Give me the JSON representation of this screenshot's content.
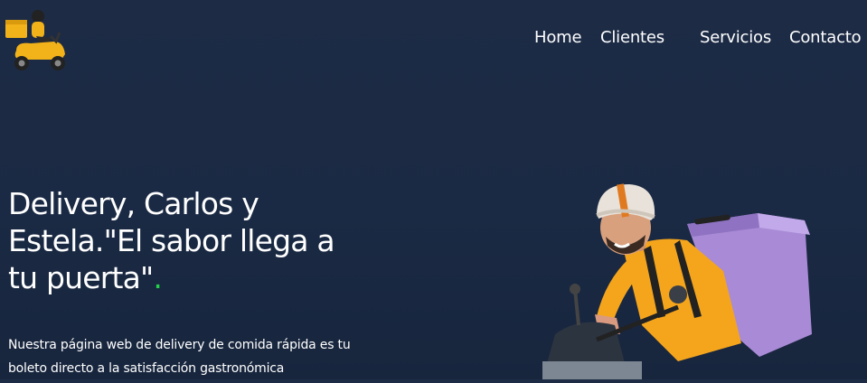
{
  "brand": {
    "logo_icon": "delivery-scooter-icon"
  },
  "nav": {
    "items": [
      {
        "label": "Home"
      },
      {
        "label": "Clientes"
      },
      {
        "label": "Servicios"
      },
      {
        "label": "Contacto"
      }
    ]
  },
  "hero": {
    "title": "Delivery, Carlos y Estela.\"El sabor llega a tu puerta\"",
    "title_dot": ".",
    "description": "Nuestra página web de delivery de comida rápida es tu boleto directo a la satisfacción gastronómica",
    "image_icon": "delivery-rider-illustration"
  },
  "colors": {
    "background": "#1c2a44",
    "accent_dot": "#22d04a",
    "text": "#ffffff"
  }
}
